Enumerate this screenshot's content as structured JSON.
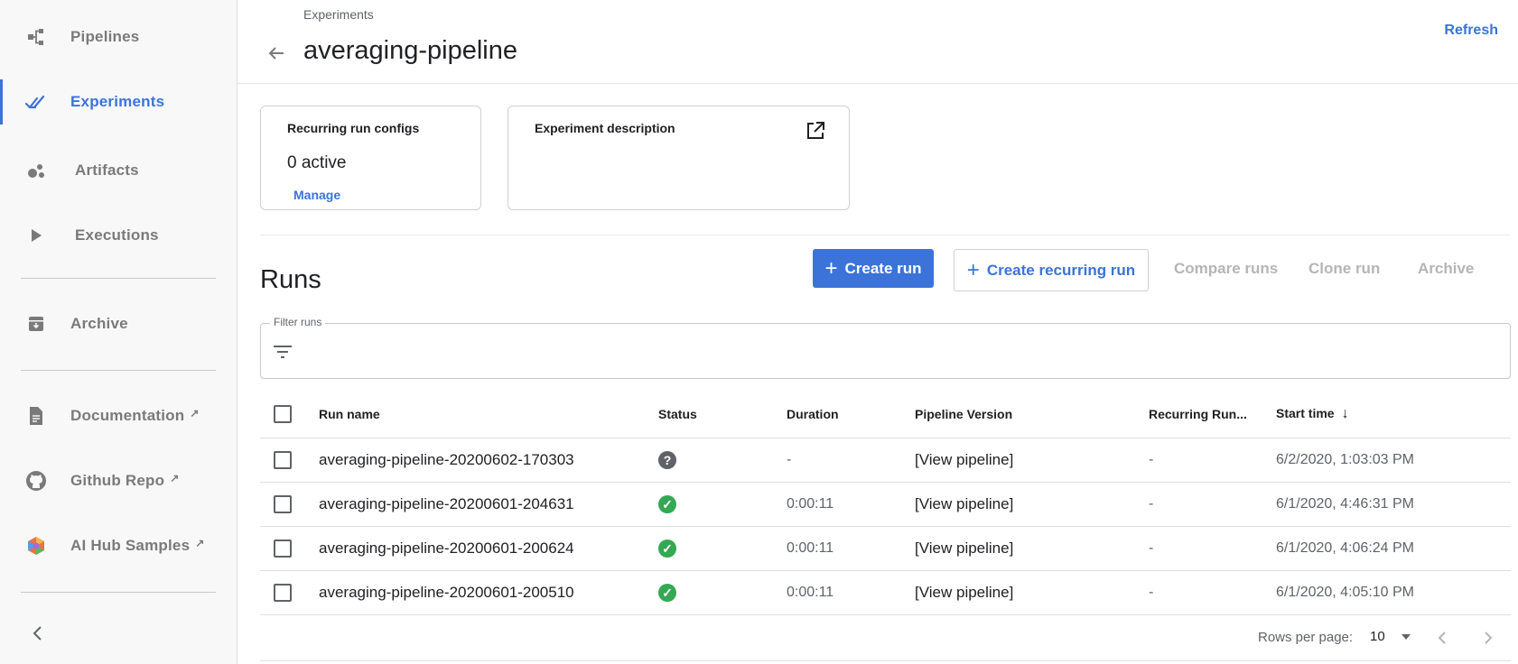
{
  "sidebar": {
    "items": [
      {
        "label": "Pipelines",
        "icon": "pipelines-icon"
      },
      {
        "label": "Experiments",
        "icon": "experiments-icon",
        "active": true
      },
      {
        "label": "Artifacts",
        "icon": "artifacts-icon"
      },
      {
        "label": "Executions",
        "icon": "executions-icon"
      },
      {
        "label": "Archive",
        "icon": "archive-icon"
      },
      {
        "label": "Documentation",
        "icon": "document-icon",
        "external": true
      },
      {
        "label": "Github Repo",
        "icon": "github-icon",
        "external": true
      },
      {
        "label": "AI Hub Samples",
        "icon": "ai-hub-icon",
        "external": true
      }
    ]
  },
  "header": {
    "breadcrumb": "Experiments",
    "title": "averaging-pipeline",
    "refresh_label": "Refresh"
  },
  "cards": {
    "recurring": {
      "title": "Recurring run configs",
      "value": "0 active",
      "link": "Manage"
    },
    "description": {
      "title": "Experiment description"
    }
  },
  "runs": {
    "title": "Runs",
    "toolbar": {
      "create_run": "Create run",
      "create_recurring_run": "Create recurring run",
      "compare_runs": "Compare runs",
      "clone_run": "Clone run",
      "archive": "Archive"
    },
    "filter_label": "Filter runs",
    "columns": {
      "name": "Run name",
      "status": "Status",
      "duration": "Duration",
      "version": "Pipeline Version",
      "recurring": "Recurring Run...",
      "start": "Start time"
    },
    "rows": [
      {
        "name": "averaging-pipeline-20200602-170303",
        "status": "unknown",
        "duration": "-",
        "version": "[View pipeline]",
        "recurring": "-",
        "start": "6/2/2020, 1:03:03 PM"
      },
      {
        "name": "averaging-pipeline-20200601-204631",
        "status": "succeeded",
        "duration": "0:00:11",
        "version": "[View pipeline]",
        "recurring": "-",
        "start": "6/1/2020, 4:46:31 PM"
      },
      {
        "name": "averaging-pipeline-20200601-200624",
        "status": "succeeded",
        "duration": "0:00:11",
        "version": "[View pipeline]",
        "recurring": "-",
        "start": "6/1/2020, 4:06:24 PM"
      },
      {
        "name": "averaging-pipeline-20200601-200510",
        "status": "succeeded",
        "duration": "0:00:11",
        "version": "[View pipeline]",
        "recurring": "-",
        "start": "6/1/2020, 4:05:10 PM"
      }
    ],
    "footer": {
      "rows_per_page_label": "Rows per page:",
      "rows_per_page_value": "10"
    }
  },
  "colors": {
    "accent": "#3b73d9",
    "success": "#34a853",
    "muted": "#7a7a7a"
  }
}
